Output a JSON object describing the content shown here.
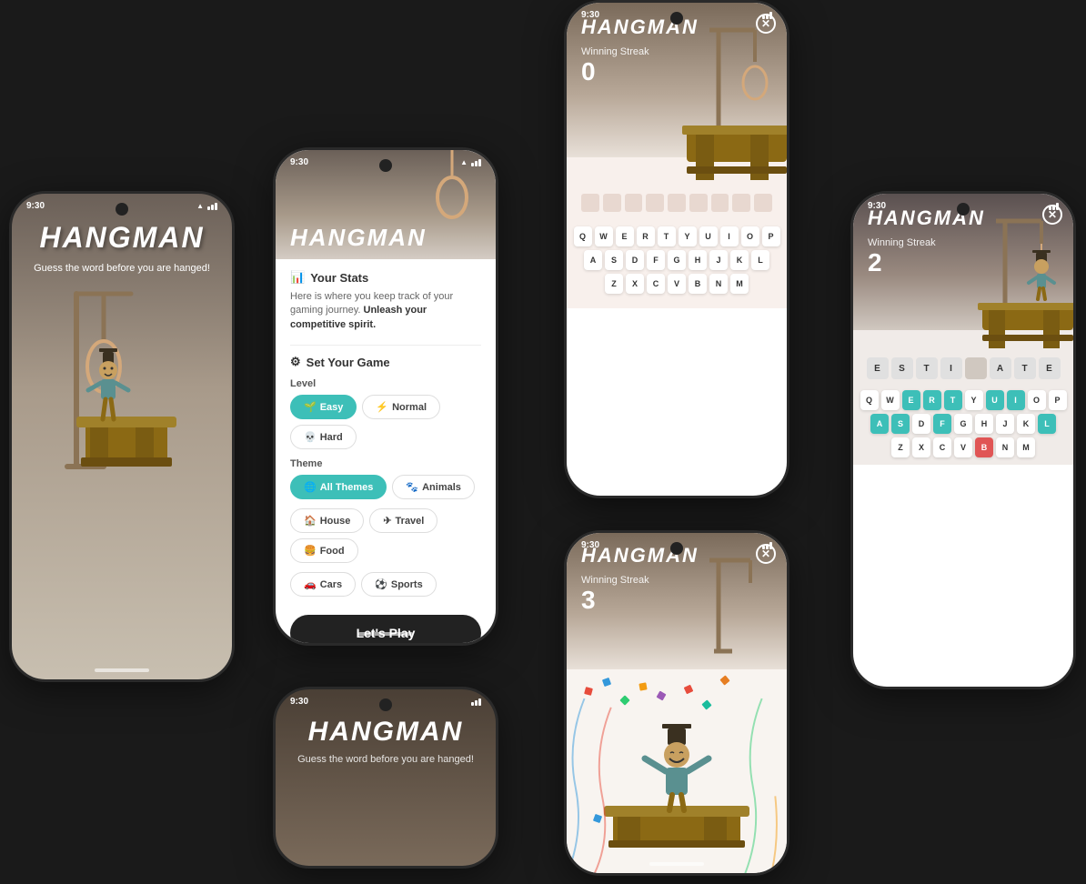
{
  "phones": {
    "phone1": {
      "time": "9:30",
      "title": "HANGMAN",
      "subtitle": "Guess the word\nbefore you are hanged!",
      "bg_gradient": "left splash"
    },
    "phone2": {
      "time": "9:30",
      "title": "HANGMAN",
      "stats_icon": "📊",
      "stats_title": "Your Stats",
      "stats_text": "Here is where you keep track of your gaming journey.",
      "stats_bold": "Unleash your competitive spirit.",
      "set_game_title": "Set Your Game",
      "level_label": "Level",
      "levels": [
        "Easy",
        "Normal",
        "Hard"
      ],
      "active_level": "Easy",
      "theme_label": "Theme",
      "themes": [
        "All Themes",
        "Animals",
        "House",
        "Travel",
        "Food",
        "Cars",
        "Sports"
      ],
      "active_theme": "All Themes",
      "play_btn": "Let's Play"
    },
    "phone3": {
      "time": "9:30",
      "title": "HANGMAN",
      "streak_label": "Winning Streak",
      "streak": "0",
      "word_length": 9,
      "keyboard_rows": [
        [
          "Q",
          "W",
          "E",
          "R",
          "T",
          "Y",
          "U",
          "I",
          "O",
          "P"
        ],
        [
          "A",
          "S",
          "D",
          "F",
          "G",
          "H",
          "J",
          "K",
          "L"
        ],
        [
          "Z",
          "X",
          "C",
          "V",
          "B",
          "N",
          "M"
        ]
      ]
    },
    "phone4": {
      "time": "9:30",
      "title": "HANGMAN",
      "subtitle": "Guess the word\nbefore you are hanged!"
    },
    "phone5": {
      "time": "9:30",
      "title": "HANGMAN",
      "streak_label": "Winning Streak",
      "streak": "3",
      "close_label": "×"
    },
    "phone6": {
      "time": "9:30",
      "title": "HANGMAN",
      "streak_label": "Winning Streak",
      "streak": "2",
      "letters": [
        "E",
        "S",
        "T",
        "I",
        "",
        "A",
        "T",
        "E"
      ],
      "keyboard_rows": [
        [
          "Q",
          "W",
          "E",
          "R",
          "T",
          "Y",
          "U",
          "I",
          "O",
          "P"
        ],
        [
          "A",
          "S",
          "D",
          "F",
          "G",
          "H",
          "J",
          "K",
          "L"
        ],
        [
          "Z",
          "X",
          "C",
          "V",
          "B",
          "N",
          "M"
        ]
      ],
      "used_correct": [
        "E",
        "R",
        "T",
        "U",
        "I",
        "A",
        "S",
        "F",
        "L"
      ],
      "used_wrong": [
        "B"
      ]
    }
  }
}
